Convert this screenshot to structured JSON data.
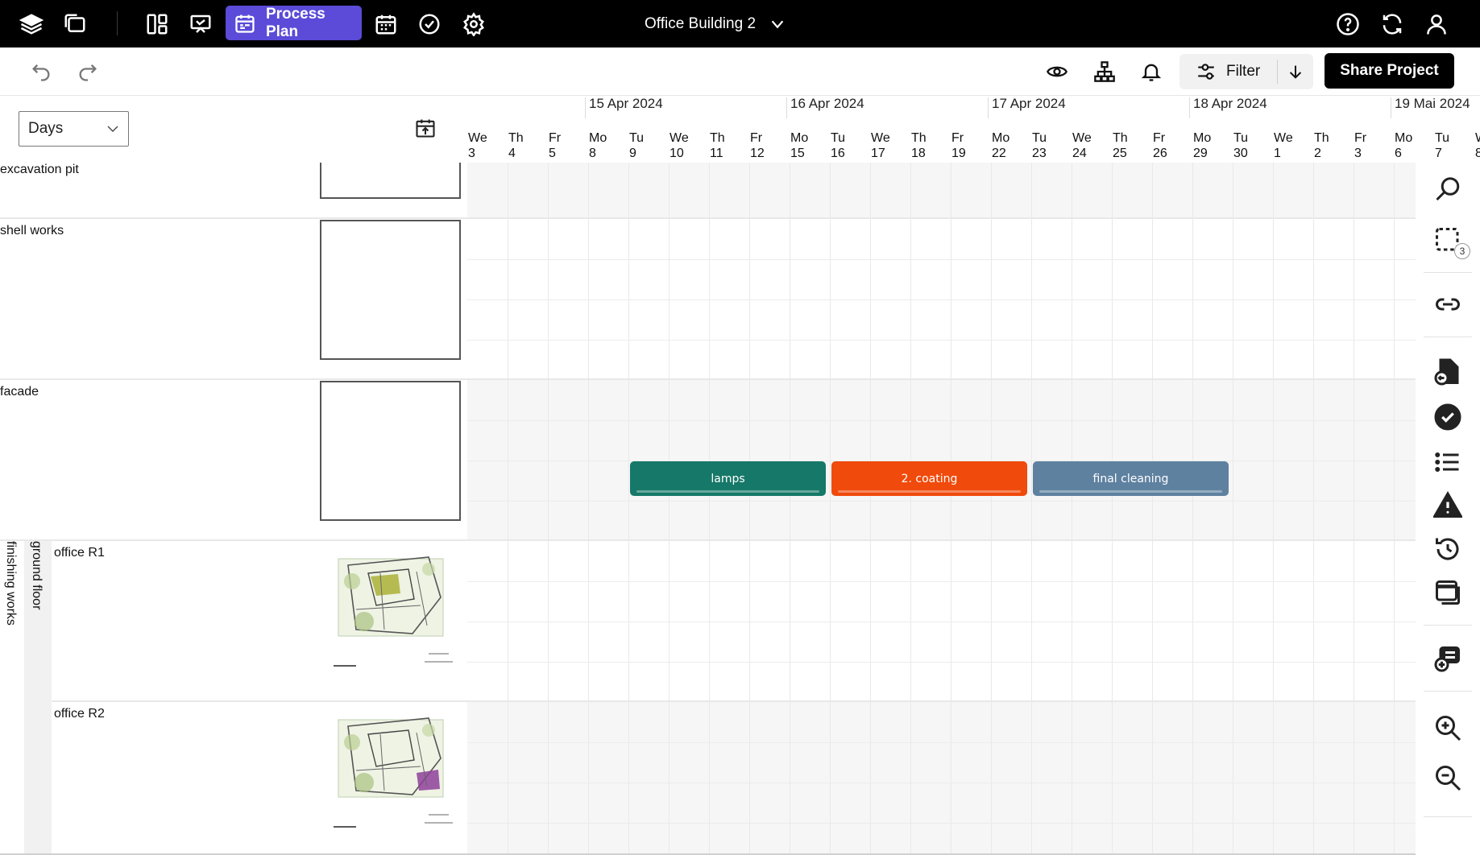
{
  "topbar": {
    "active_tab_label": "Process Plan",
    "project_name": "Office Building 2"
  },
  "toolbar": {
    "filter_label": "Filter",
    "share_label": "Share Project"
  },
  "view": {
    "scale_value": "Days"
  },
  "timeline": {
    "weeks": [
      "15 Apr 2024",
      "16 Apr 2024",
      "17 Apr 2024",
      "18 Apr 2024",
      "19 Mai 2024"
    ],
    "days": [
      {
        "dow": "We",
        "num": "3"
      },
      {
        "dow": "Th",
        "num": "4"
      },
      {
        "dow": "Fr",
        "num": "5"
      },
      {
        "dow": "Mo",
        "num": "8"
      },
      {
        "dow": "Tu",
        "num": "9"
      },
      {
        "dow": "We",
        "num": "10"
      },
      {
        "dow": "Th",
        "num": "11"
      },
      {
        "dow": "Fr",
        "num": "12"
      },
      {
        "dow": "Mo",
        "num": "15"
      },
      {
        "dow": "Tu",
        "num": "16"
      },
      {
        "dow": "We",
        "num": "17"
      },
      {
        "dow": "Th",
        "num": "18"
      },
      {
        "dow": "Fr",
        "num": "19"
      },
      {
        "dow": "Mo",
        "num": "22"
      },
      {
        "dow": "Tu",
        "num": "23"
      },
      {
        "dow": "We",
        "num": "24"
      },
      {
        "dow": "Th",
        "num": "25"
      },
      {
        "dow": "Fr",
        "num": "26"
      },
      {
        "dow": "Mo",
        "num": "29"
      },
      {
        "dow": "Tu",
        "num": "30"
      },
      {
        "dow": "We",
        "num": "1"
      },
      {
        "dow": "Th",
        "num": "2"
      },
      {
        "dow": "Fr",
        "num": "3"
      },
      {
        "dow": "Mo",
        "num": "6"
      },
      {
        "dow": "Tu",
        "num": "7"
      },
      {
        "dow": "W",
        "num": "8"
      }
    ]
  },
  "rows": {
    "excavation": "excavation pit",
    "shell": "shell works",
    "facade": "facade",
    "office_r1": "office R1",
    "office_r2": "office R2",
    "group_floor": "ground floor",
    "group_phase": "finishing works"
  },
  "tasks": [
    {
      "label": "lamps",
      "color": "#167868"
    },
    {
      "label": "2. coating",
      "color": "#f04a0c"
    },
    {
      "label": "final cleaning",
      "color": "#5e81a0"
    }
  ],
  "sidebar": {
    "selection_count": "3"
  },
  "colors": {
    "accent": "#5b4bd8",
    "topbar": "#000000"
  }
}
